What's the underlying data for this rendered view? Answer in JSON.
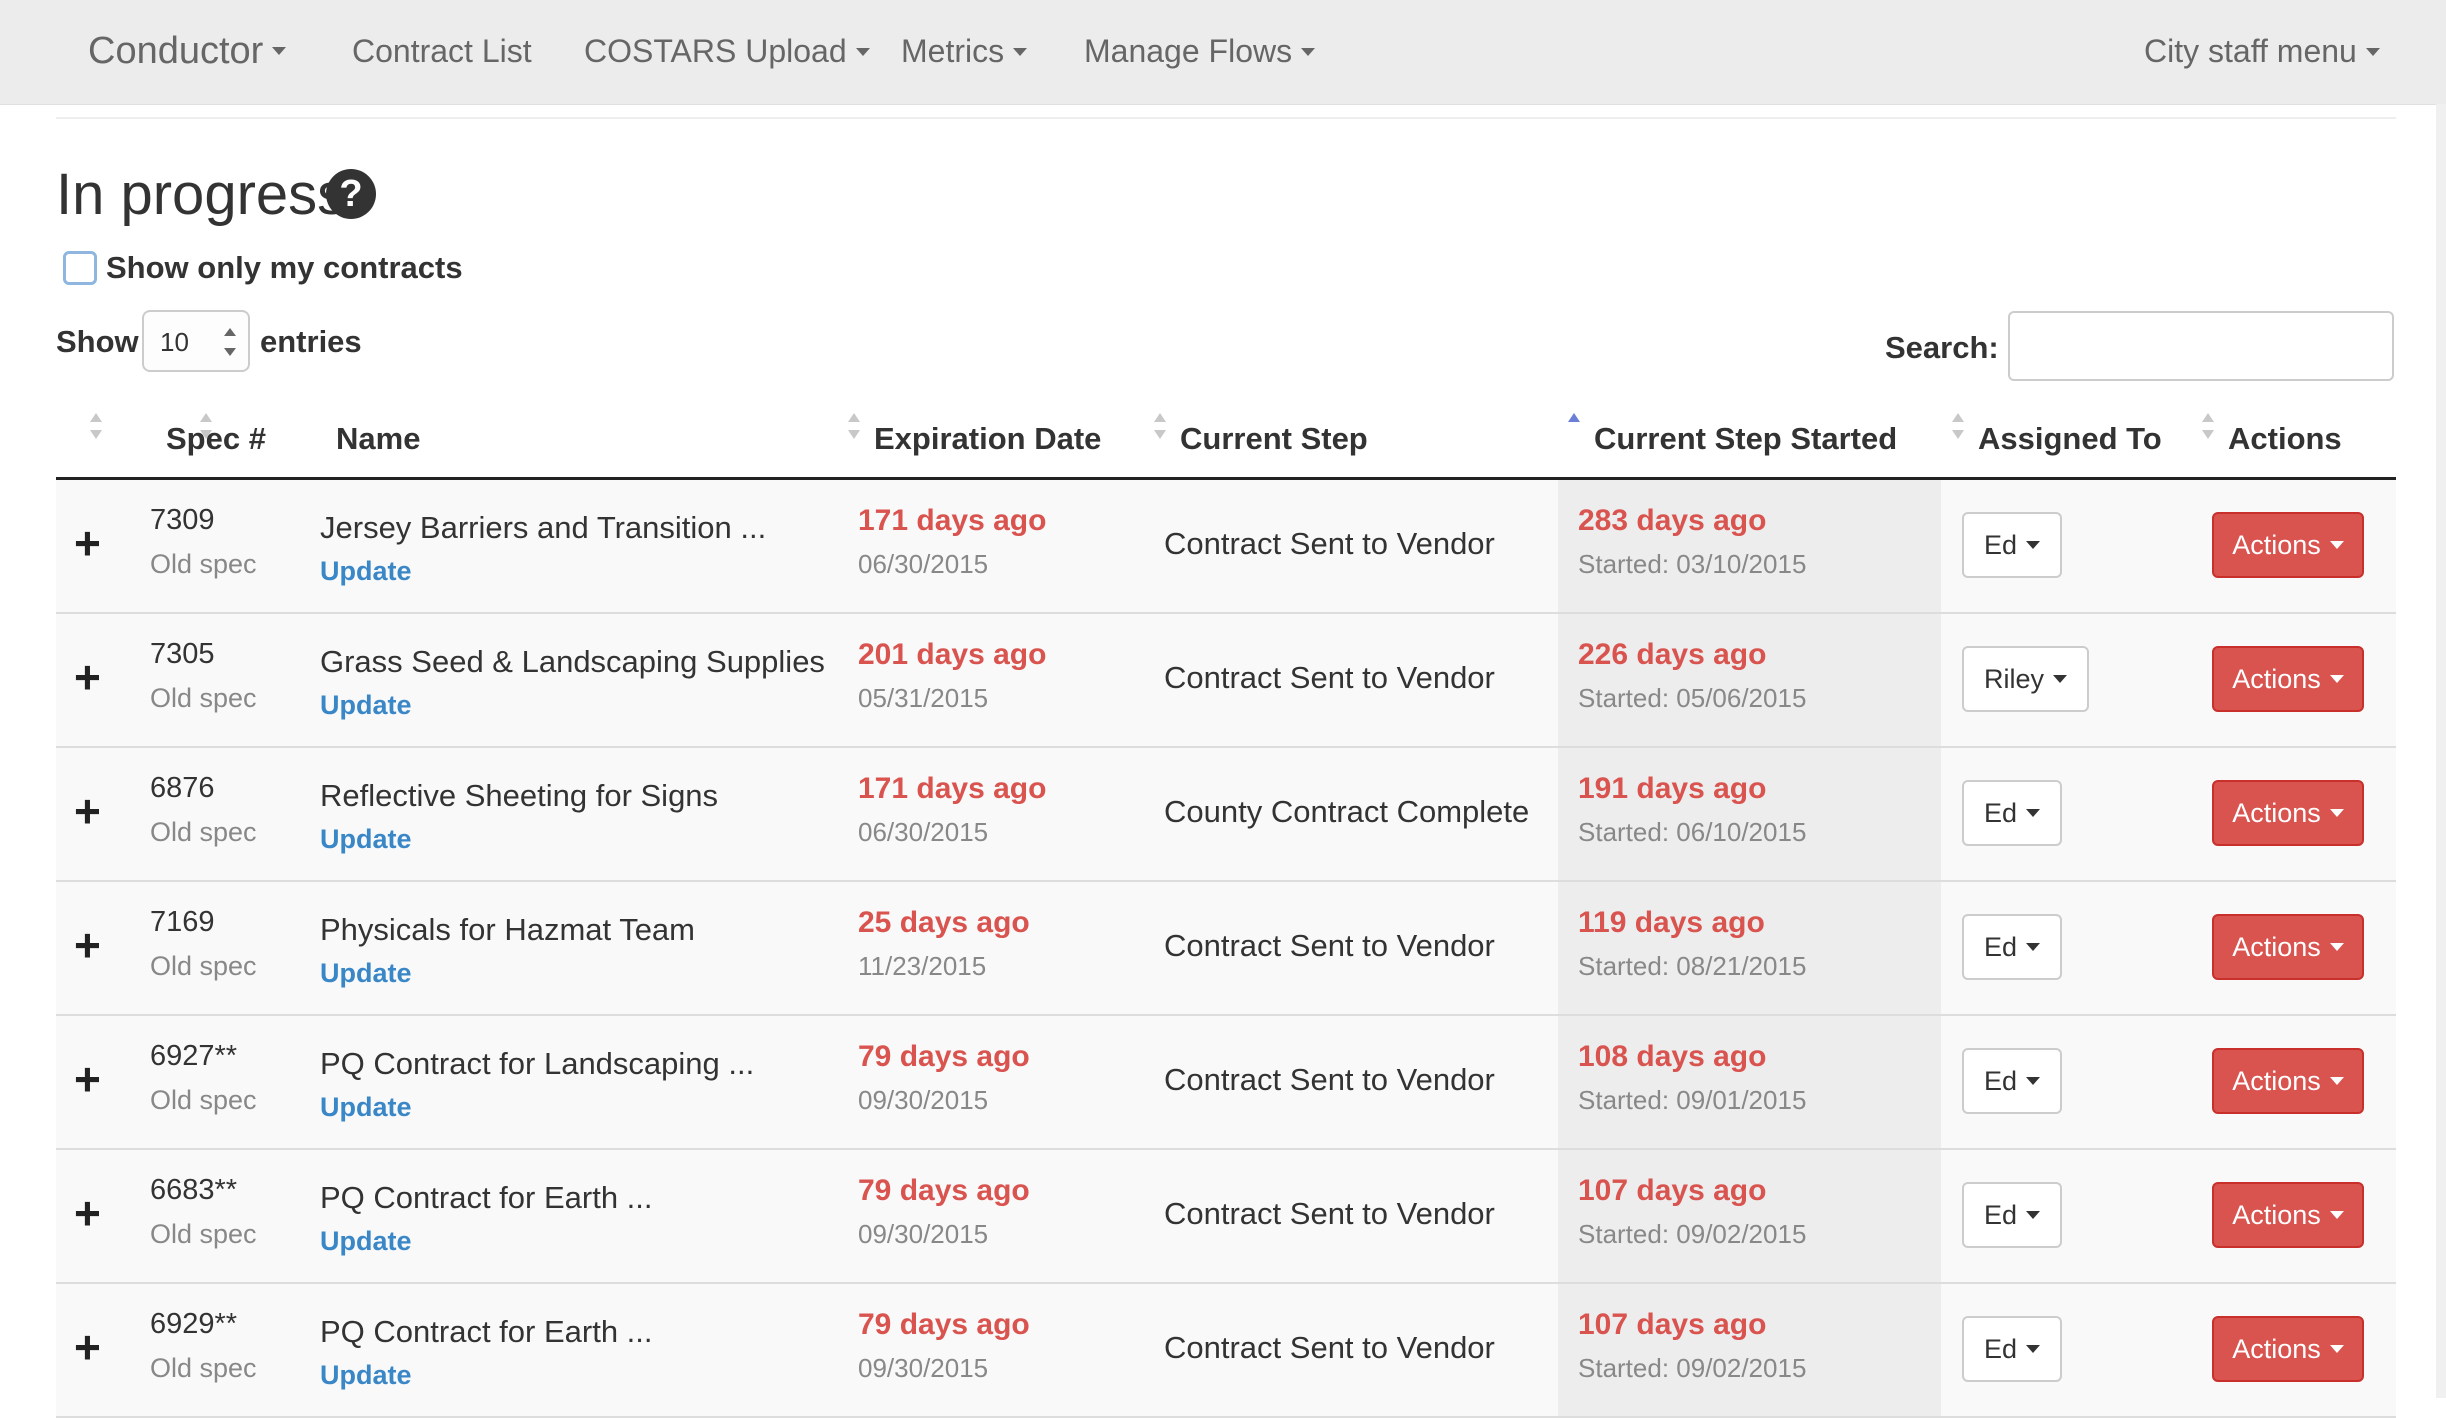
{
  "nav": {
    "brand": "Conductor",
    "contract_list": "Contract List",
    "costars_upload": "COSTARS Upload",
    "metrics": "Metrics",
    "manage_flows": "Manage Flows",
    "staff_menu": "City staff menu"
  },
  "page": {
    "title": "In progress",
    "help_icon": "question-circle-icon",
    "filter_label": "Show only my contracts",
    "filter_checked": false,
    "show_label": "Show",
    "entries_value": "10",
    "entries_label": "entries",
    "search_label": "Search:",
    "search_value": ""
  },
  "table": {
    "columns": [
      "Spec #",
      "Name",
      "Expiration Date",
      "Current Step",
      "Current Step Started",
      "Assigned To",
      "Actions"
    ],
    "sorted_column": "Current Step Started",
    "sort_direction": "ascending",
    "rows": [
      {
        "spec": "7309",
        "spec_type": "Old spec",
        "name": "Jersey Barriers and Transition ...",
        "link": "Update",
        "exp_ago": "171 days ago",
        "exp_date": "06/30/2015",
        "step": "Contract Sent to Vendor",
        "step_ago": "283 days ago",
        "step_started": "Started: 03/10/2015",
        "assigned": "Ed",
        "actions": "Actions"
      },
      {
        "spec": "7305",
        "spec_type": "Old spec",
        "name": "Grass Seed & Landscaping Supplies",
        "link": "Update",
        "exp_ago": "201 days ago",
        "exp_date": "05/31/2015",
        "step": "Contract Sent to Vendor",
        "step_ago": "226 days ago",
        "step_started": "Started: 05/06/2015",
        "assigned": "Riley",
        "actions": "Actions"
      },
      {
        "spec": "6876",
        "spec_type": "Old spec",
        "name": "Reflective Sheeting for Signs",
        "link": "Update",
        "exp_ago": "171 days ago",
        "exp_date": "06/30/2015",
        "step": "County Contract Complete",
        "step_ago": "191 days ago",
        "step_started": "Started: 06/10/2015",
        "assigned": "Ed",
        "actions": "Actions"
      },
      {
        "spec": "7169",
        "spec_type": "Old spec",
        "name": "Physicals for Hazmat Team",
        "link": "Update",
        "exp_ago": "25 days ago",
        "exp_date": "11/23/2015",
        "step": "Contract Sent to Vendor",
        "step_ago": "119 days ago",
        "step_started": "Started: 08/21/2015",
        "assigned": "Ed",
        "actions": "Actions"
      },
      {
        "spec": "6927**",
        "spec_type": "Old spec",
        "name": "PQ Contract for Landscaping ...",
        "link": "Update",
        "exp_ago": "79 days ago",
        "exp_date": "09/30/2015",
        "step": "Contract Sent to Vendor",
        "step_ago": "108 days ago",
        "step_started": "Started: 09/01/2015",
        "assigned": "Ed",
        "actions": "Actions"
      },
      {
        "spec": "6683**",
        "spec_type": "Old spec",
        "name": "PQ Contract for Earth ...",
        "link": "Update",
        "exp_ago": "79 days ago",
        "exp_date": "09/30/2015",
        "step": "Contract Sent to Vendor",
        "step_ago": "107 days ago",
        "step_started": "Started: 09/02/2015",
        "assigned": "Ed",
        "actions": "Actions"
      },
      {
        "spec": "6929**",
        "spec_type": "Old spec",
        "name": "PQ Contract for Earth ...",
        "link": "Update",
        "exp_ago": "79 days ago",
        "exp_date": "09/30/2015",
        "step": "Contract Sent to Vendor",
        "step_ago": "107 days ago",
        "step_started": "Started: 09/02/2015",
        "assigned": "Ed",
        "actions": "Actions"
      }
    ]
  },
  "colors": {
    "danger": "#d9534f",
    "link": "#3a87c8",
    "navbar": "#ececec",
    "sort_active": "#6b7fd6"
  }
}
